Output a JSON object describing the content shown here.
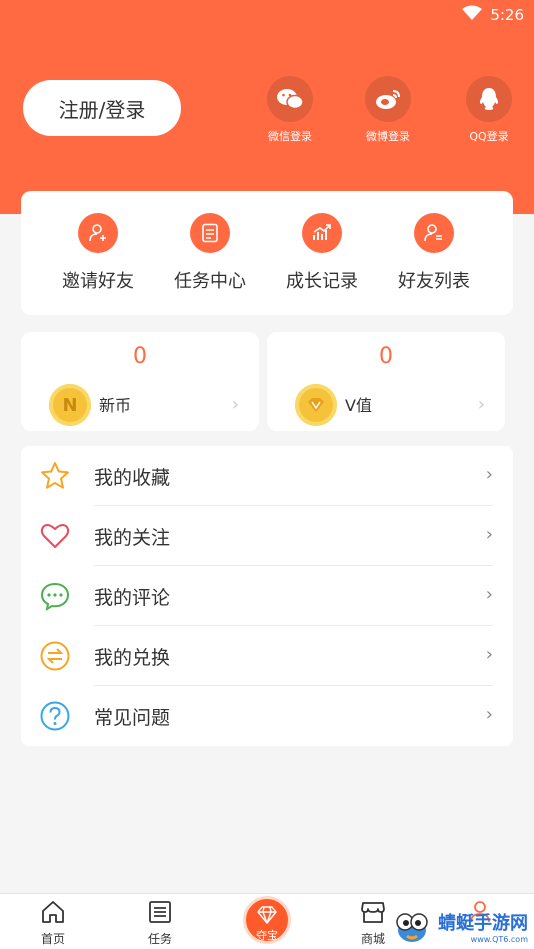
{
  "status_bar": {
    "time": "5:26"
  },
  "header": {
    "login_label": "注册/登录",
    "social": [
      {
        "label": "微信登录",
        "icon": "wechat-icon"
      },
      {
        "label": "微博登录",
        "icon": "weibo-icon"
      },
      {
        "label": "QQ登录",
        "icon": "qq-icon"
      }
    ]
  },
  "quick_actions": [
    {
      "label": "邀请好友",
      "icon": "invite-user-icon"
    },
    {
      "label": "任务中心",
      "icon": "task-list-icon"
    },
    {
      "label": "成长记录",
      "icon": "growth-chart-icon"
    },
    {
      "label": "好友列表",
      "icon": "friend-list-icon"
    }
  ],
  "wallet": [
    {
      "value": "0",
      "label": "新币",
      "icon": "n-coin-icon"
    },
    {
      "value": "0",
      "label": "V值",
      "icon": "v-coin-icon"
    }
  ],
  "menu": [
    {
      "label": "我的收藏",
      "icon": "star-icon",
      "color": "#f5a623"
    },
    {
      "label": "我的关注",
      "icon": "heart-icon",
      "color": "#e84b5e"
    },
    {
      "label": "我的评论",
      "icon": "comment-icon",
      "color": "#4caf50"
    },
    {
      "label": "我的兑换",
      "icon": "exchange-icon",
      "color": "#f5a623"
    },
    {
      "label": "常见问题",
      "icon": "question-icon",
      "color": "#3aa5e6"
    }
  ],
  "tabbar": [
    {
      "label": "首页",
      "icon": "home-icon"
    },
    {
      "label": "任务",
      "icon": "task-icon"
    },
    {
      "label": "夺宝",
      "icon": "diamond-icon"
    },
    {
      "label": "商城",
      "icon": "store-icon"
    }
  ],
  "watermark": {
    "text": "蜻蜓手游网",
    "sub": "www.QT6.com"
  },
  "colors": {
    "accent": "#ff6a42",
    "background": "#f5f5f5"
  }
}
